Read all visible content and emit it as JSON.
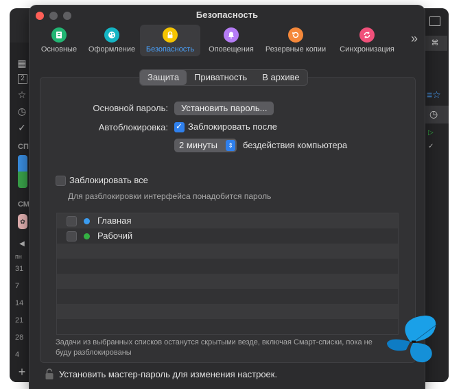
{
  "window": {
    "title": "Безопасность"
  },
  "toolbar": {
    "items": [
      {
        "label": "Основные",
        "icon": "general-icon",
        "color": "#22b573"
      },
      {
        "label": "Оформление",
        "icon": "appearance-icon",
        "color": "#14b5c4"
      },
      {
        "label": "Безопасность",
        "icon": "lock-icon",
        "color": "#f5c400"
      },
      {
        "label": "Оповещения",
        "icon": "notification-icon",
        "color": "#b57cf5"
      },
      {
        "label": "Резервные копии",
        "icon": "backup-icon",
        "color": "#f5883a"
      },
      {
        "label": "Синхронизация",
        "icon": "sync-icon",
        "color": "#f0507a"
      }
    ],
    "more": "»"
  },
  "tabs": [
    "Защита",
    "Приватность",
    "В архиве"
  ],
  "form": {
    "password_label": "Основной пароль:",
    "set_password_button": "Установить пароль...",
    "autolock_label": "Автоблокировка:",
    "autolock_checkbox": "Заблокировать после",
    "duration_value": "2 минуты",
    "idle_text": "бездействия компьютера",
    "lock_all_label": "Заблокировать все",
    "lock_all_hint": "Для разблокировки интерфейса понадобится пароль"
  },
  "lists": [
    {
      "name": "Главная",
      "color": "#3b9cf0"
    },
    {
      "name": "Рабочий",
      "color": "#34b043"
    }
  ],
  "footnote": "Задачи из выбранных списков останутся скрытыми везде, включая Смарт-списки, пока не буду разблокированы",
  "lock_footer": "Установить мастер-пароль для изменения настроек.",
  "bg_sidebar": {
    "section1": "СП",
    "section2": "СМ",
    "weekday": "пн",
    "dates": [
      "31",
      "7",
      "14",
      "21",
      "28",
      "4"
    ]
  }
}
